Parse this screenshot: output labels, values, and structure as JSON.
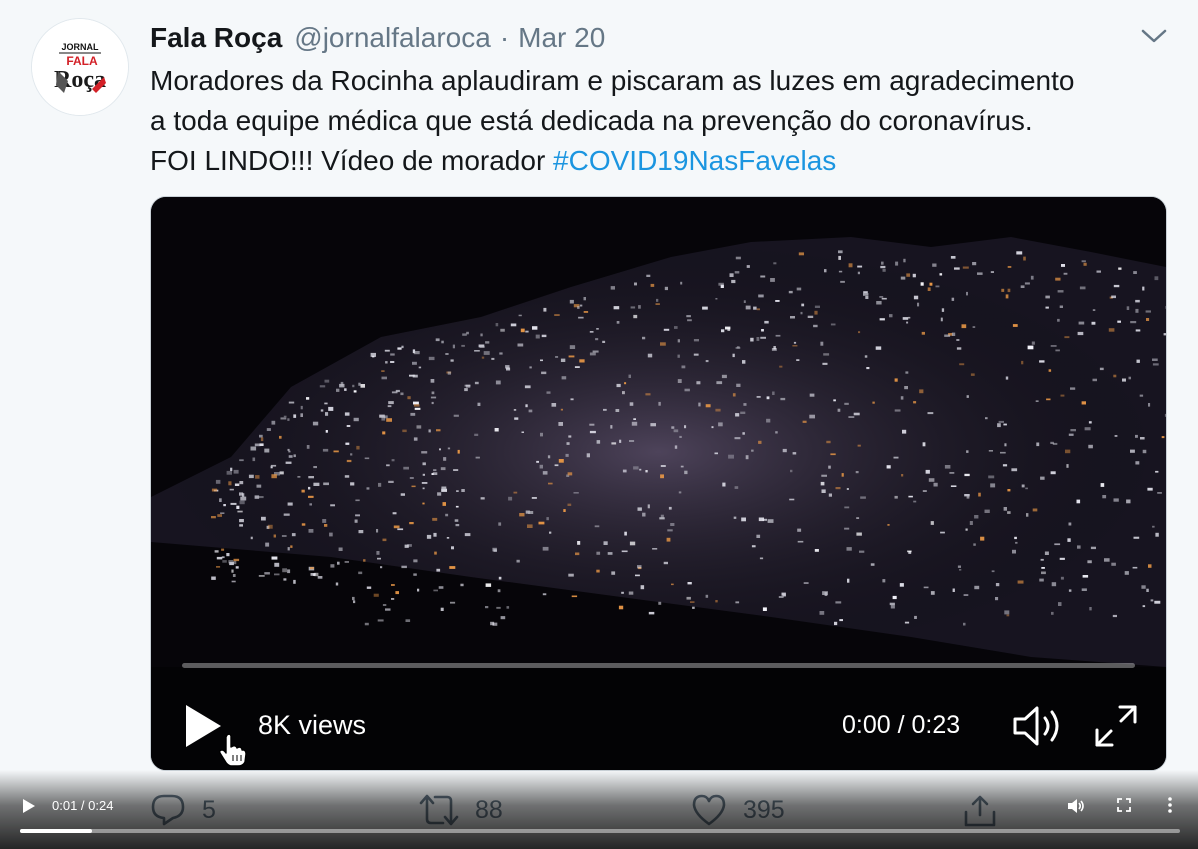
{
  "tweet": {
    "display_name": "Fala Roça",
    "handle": "@jornalfalaroca",
    "separator": "·",
    "date": "Mar 20",
    "avatar": {
      "top_text": "JORNAL",
      "logo_text": "FALA",
      "logo_text_2": "Roça"
    },
    "text": {
      "line1": "Moradores da Rocinha aplaudiram e piscaram as luzes em agradecimento",
      "line2": "a toda equipe médica que está dedicada na prevenção do coronavírus.",
      "line3_prefix": "FOI LINDO!!! Vídeo de morador ",
      "hashtag": "#COVID19NasFavelas"
    },
    "colors": {
      "link": "#1b95e0",
      "muted": "#657786",
      "text": "#14171a"
    }
  },
  "video": {
    "views": "8K views",
    "time": "0:00 / 0:23",
    "progress": 0
  },
  "actions": {
    "replies": "5",
    "retweets": "88",
    "likes": "395"
  },
  "native_player": {
    "time": "0:01 / 0:24",
    "progress": 0.062
  }
}
